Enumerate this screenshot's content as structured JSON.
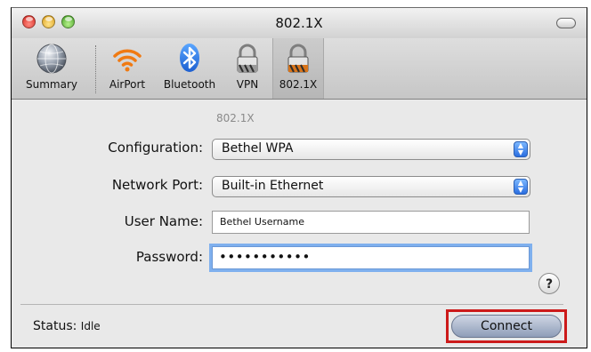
{
  "window": {
    "title": "802.1X"
  },
  "toolbar": {
    "items": [
      {
        "label": "Summary",
        "icon": "globe-icon"
      },
      {
        "label": "AirPort",
        "icon": "wifi-icon"
      },
      {
        "label": "Bluetooth",
        "icon": "bluetooth-icon"
      },
      {
        "label": "VPN",
        "icon": "lock-icon"
      },
      {
        "label": "802.1X",
        "icon": "lock-striped-icon"
      }
    ],
    "selected": "802.1X"
  },
  "form": {
    "section_label": "802.1X",
    "configuration": {
      "label": "Configuration:",
      "value": "Bethel WPA"
    },
    "network_port": {
      "label": "Network Port:",
      "value": "Built-in Ethernet"
    },
    "user_name": {
      "label": "User Name:",
      "value": "Bethel Username"
    },
    "password": {
      "label": "Password:",
      "value": "•••••••••••"
    },
    "help_label": "?"
  },
  "footer": {
    "status_label": "Status:",
    "status_value": "Idle",
    "connect_label": "Connect"
  },
  "colors": {
    "highlight_outline": "#cc1a1a",
    "focus_ring": "#7fb0ee",
    "popup_button": "#2a6ee0"
  }
}
